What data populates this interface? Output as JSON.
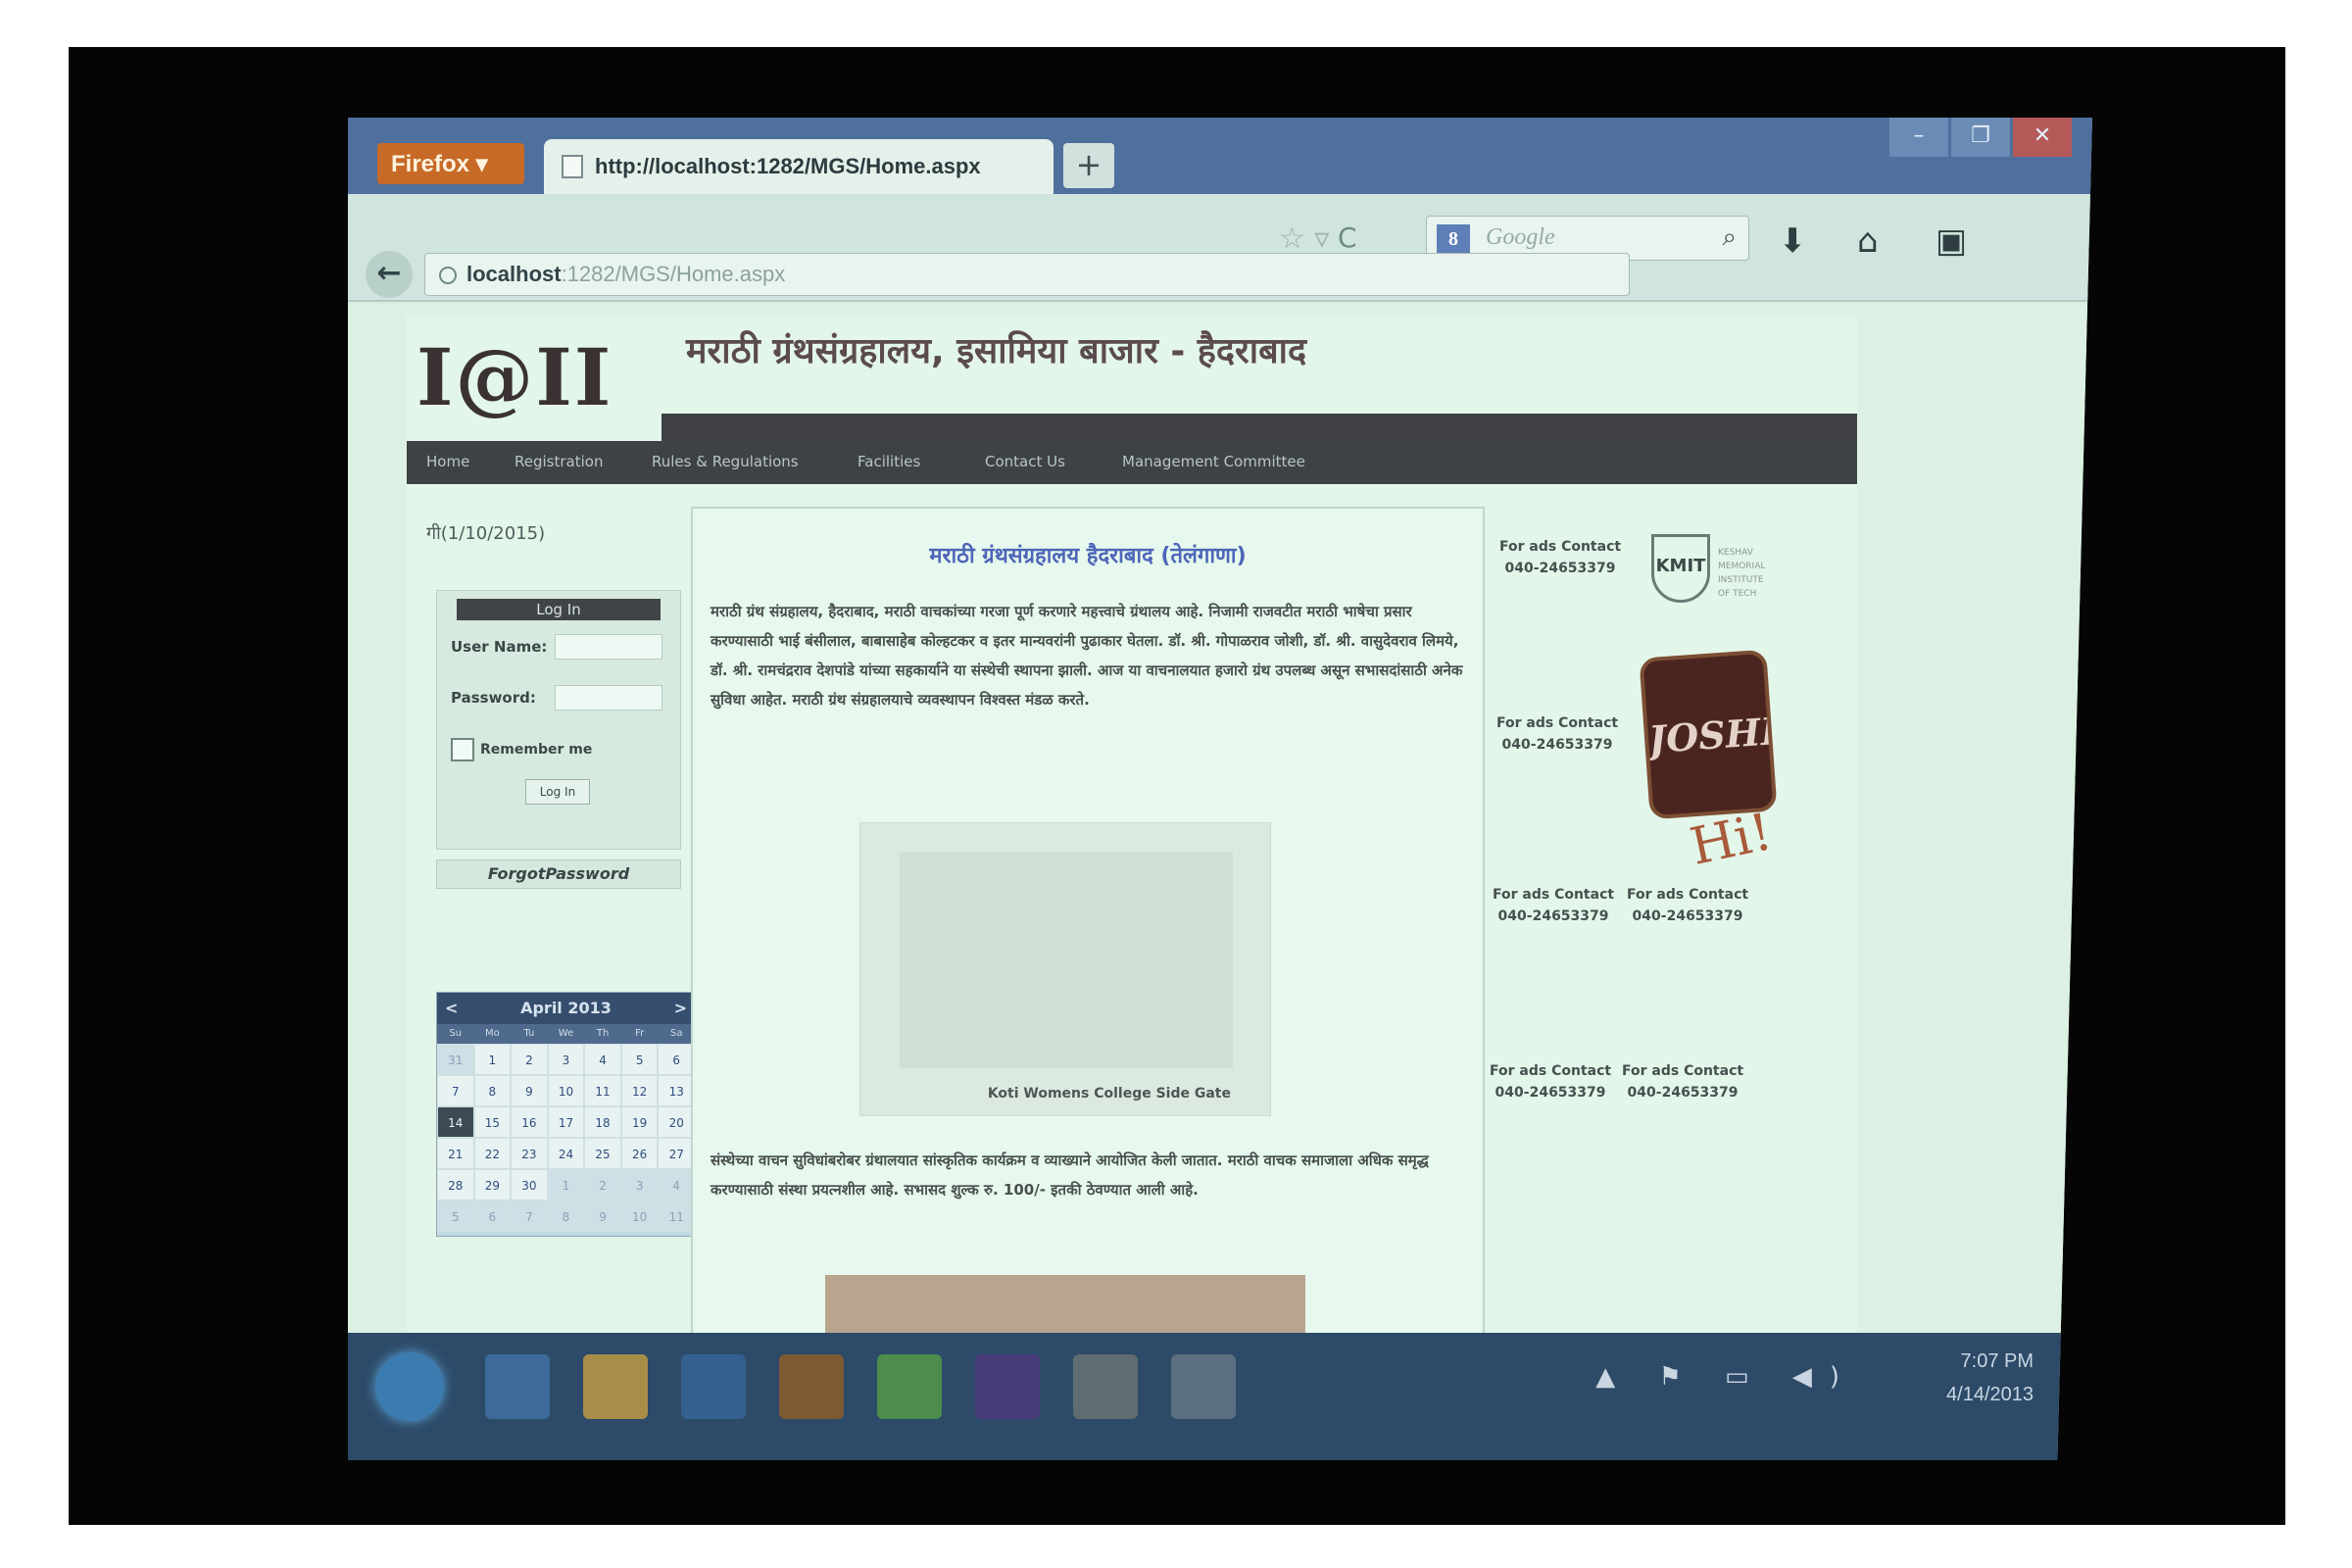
{
  "browser": {
    "app_button": "Firefox",
    "tab_title": "http://localhost:1282/MGS/Home.aspx",
    "new_tab": "+",
    "url_host": "localhost",
    "url_path": ":1282/MGS/Home.aspx",
    "search_placeholder": "Google",
    "search_engine_icon": "8",
    "window_controls": [
      "–",
      "❐",
      "✕"
    ]
  },
  "site": {
    "logo": "I@II",
    "title": "मराठी ग्रंथसंग्रहालय, इसामिया बाजार - हैदराबाद",
    "menu": [
      "Home",
      "Registration",
      "Rules & Regulations",
      "Facilities",
      "Contact Us",
      "Management Committee"
    ],
    "date": "गी(1/10/2015)"
  },
  "login": {
    "header": "Log In",
    "username_label": "User Name:",
    "password_label": "Password:",
    "remember_label": "Remember me",
    "button": "Log In",
    "forgot": "ForgotPassword"
  },
  "calendar": {
    "prev": "<",
    "title": "April 2013",
    "next": ">",
    "dows": [
      "Su",
      "Mo",
      "Tu",
      "We",
      "Th",
      "Fr",
      "Sa"
    ],
    "days": [
      "31",
      "1",
      "2",
      "3",
      "4",
      "5",
      "6",
      "7",
      "8",
      "9",
      "10",
      "11",
      "12",
      "13",
      "14",
      "15",
      "16",
      "17",
      "18",
      "19",
      "20",
      "21",
      "22",
      "23",
      "24",
      "25",
      "26",
      "27",
      "28",
      "29",
      "30",
      "1",
      "2",
      "3",
      "4",
      "5",
      "6",
      "7",
      "8",
      "9",
      "10",
      "11"
    ]
  },
  "article": {
    "title": "मराठी ग्रंथसंग्रहालय हैदराबाद (तेलंगाणा)",
    "para1": "मराठी ग्रंथ संग्रहालय, हैदराबाद, मराठी वाचकांच्या गरजा पूर्ण करणारे महत्त्वाचे ग्रंथालय आहे. निजामी राजवटीत मराठी भाषेचा प्रसार करण्यासाठी भाई बंसीलाल, बाबासाहेब कोल्हटकर व इतर मान्यवरांनी पुढाकार घेतला. डॉ. श्री. गोपाळराव जोशी, डॉ. श्री. वासुदेवराव लिमये, डॉ. श्री. रामचंद्रराव देशपांडे यांच्या सहकार्याने या संस्थेची स्थापना झाली. आज या वाचनालयात हजारो ग्रंथ उपलब्ध असून सभासदांसाठी अनेक सुविधा आहेत. मराठी ग्रंथ संग्रहालयाचे व्यवस्थापन विश्वस्त मंडळ करते.",
    "photo_caption": "Koti Womens College Side Gate",
    "para2": "संस्थेच्या वाचन सुविधांबरोबर ग्रंथालयात सांस्कृतिक कार्यक्रम व व्याख्याने आयोजित केली जातात. मराठी वाचक समाजाला अधिक समृद्ध करण्यासाठी संस्था प्रयत्नशील आहे. सभासद शुल्क रु. 100/- इतकी ठेवण्यात आली आहे."
  },
  "ads": {
    "contact_label": "For ads Contact",
    "phone": "040-24653379",
    "kmit_name": "KMIT",
    "kmit_lines": [
      "KESHAV",
      "MEMORIAL",
      "INSTITUTE",
      "OF TECH"
    ],
    "joshis": "JOSHI'S",
    "handwriting": "Hi!"
  },
  "taskbar": {
    "time": "7:07 PM",
    "date": "4/14/2013",
    "tray_icons": "▲ ⚑ ▭ ◀)"
  }
}
